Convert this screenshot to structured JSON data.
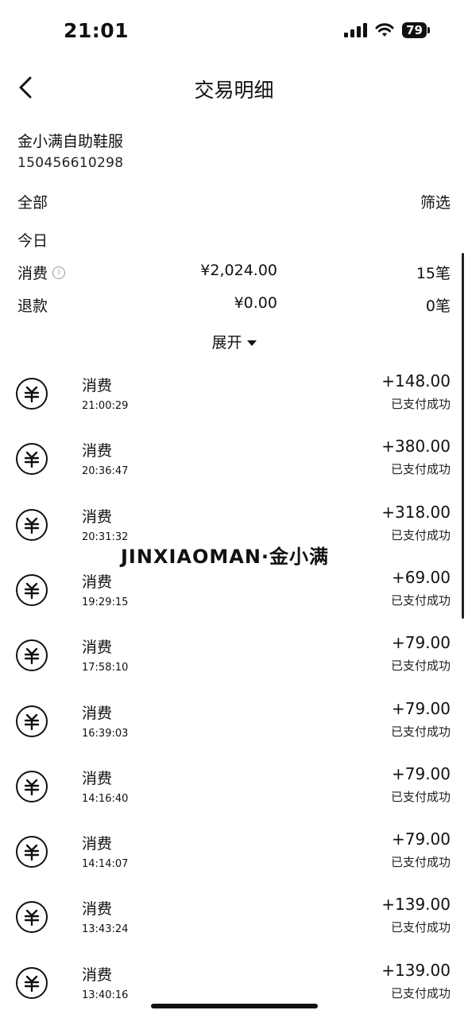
{
  "status": {
    "time": "21:01",
    "battery": "79"
  },
  "nav": {
    "title": "交易明细"
  },
  "merchant": {
    "name": "金小满自助鞋服",
    "id": "150456610298"
  },
  "filter": {
    "all_label": "全部",
    "filter_label": "筛选"
  },
  "summary": {
    "section_label": "今日",
    "consume": {
      "label": "消费",
      "amount": "¥2,024.00",
      "count": "15笔"
    },
    "refund": {
      "label": "退款",
      "amount": "¥0.00",
      "count": "0笔"
    },
    "expand_label": "展开"
  },
  "transactions": [
    {
      "type": "消费",
      "time": "21:00:29",
      "amount": "+148.00",
      "status": "已支付成功"
    },
    {
      "type": "消费",
      "time": "20:36:47",
      "amount": "+380.00",
      "status": "已支付成功"
    },
    {
      "type": "消费",
      "time": "20:31:32",
      "amount": "+318.00",
      "status": "已支付成功"
    },
    {
      "type": "消费",
      "time": "19:29:15",
      "amount": "+69.00",
      "status": "已支付成功"
    },
    {
      "type": "消费",
      "time": "17:58:10",
      "amount": "+79.00",
      "status": "已支付成功"
    },
    {
      "type": "消费",
      "time": "16:39:03",
      "amount": "+79.00",
      "status": "已支付成功"
    },
    {
      "type": "消费",
      "time": "14:16:40",
      "amount": "+79.00",
      "status": "已支付成功"
    },
    {
      "type": "消费",
      "time": "14:14:07",
      "amount": "+79.00",
      "status": "已支付成功"
    },
    {
      "type": "消费",
      "time": "13:43:24",
      "amount": "+139.00",
      "status": "已支付成功"
    },
    {
      "type": "消费",
      "time": "13:40:16",
      "amount": "+139.00",
      "status": "已支付成功"
    }
  ],
  "watermark": "JINXIAOMAN·金小满",
  "icons": {
    "transaction": "yuan-coin-icon",
    "back": "chevron-left-icon"
  }
}
